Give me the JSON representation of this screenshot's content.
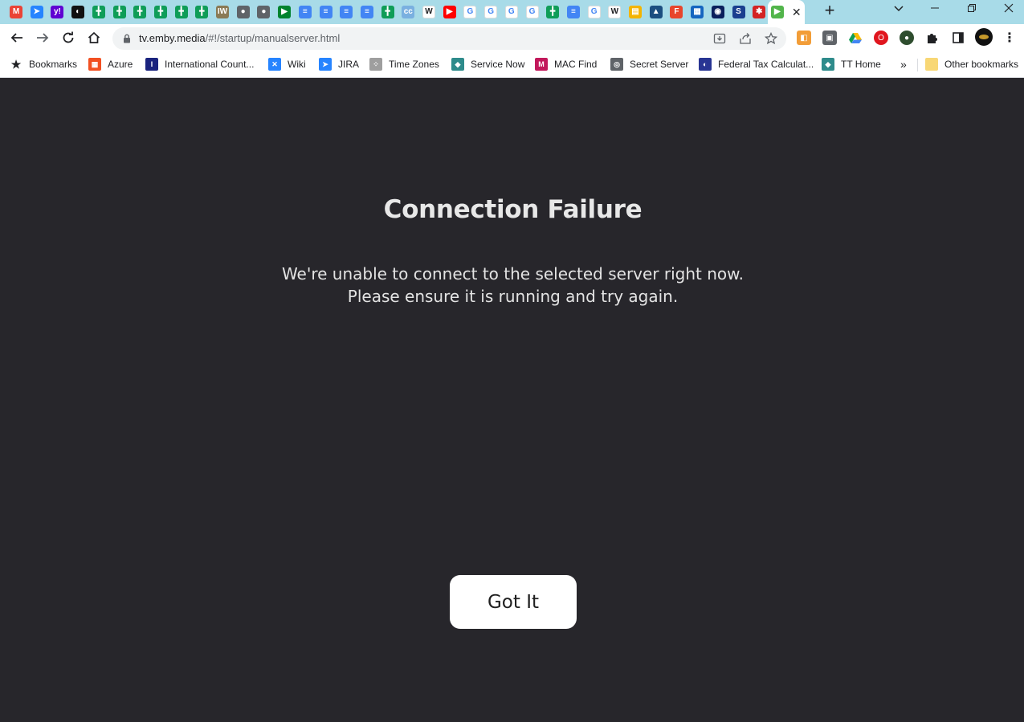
{
  "browser": {
    "tabs": [
      {
        "icon": "gmail-icon",
        "color": "#ea4335",
        "glyph": "M"
      },
      {
        "icon": "jira-icon",
        "color": "#2684ff",
        "glyph": "➤"
      },
      {
        "icon": "yahoo-icon",
        "color": "#6001d2",
        "glyph": "y!"
      },
      {
        "icon": "compass-icon",
        "color": "#111111",
        "glyph": "◐"
      },
      {
        "icon": "sheets-icon",
        "color": "#0f9d58",
        "glyph": "╋"
      },
      {
        "icon": "sheets-icon",
        "color": "#0f9d58",
        "glyph": "╋"
      },
      {
        "icon": "sheets-icon",
        "color": "#0f9d58",
        "glyph": "╋"
      },
      {
        "icon": "sheets-icon",
        "color": "#0f9d58",
        "glyph": "╋"
      },
      {
        "icon": "sheets-icon",
        "color": "#0f9d58",
        "glyph": "╋"
      },
      {
        "icon": "sheets-icon",
        "color": "#0f9d58",
        "glyph": "╋"
      },
      {
        "icon": "iw-icon",
        "color": "#8a7a55",
        "glyph": "IW"
      },
      {
        "icon": "globe-icon",
        "color": "#5f6368",
        "glyph": "●"
      },
      {
        "icon": "globe-icon",
        "color": "#5f6368",
        "glyph": "●"
      },
      {
        "icon": "meet-icon",
        "color": "#00832d",
        "glyph": "▶"
      },
      {
        "icon": "docs-icon",
        "color": "#4285f4",
        "glyph": "≡"
      },
      {
        "icon": "docs-icon",
        "color": "#4285f4",
        "glyph": "≡"
      },
      {
        "icon": "docs-icon",
        "color": "#4285f4",
        "glyph": "≡"
      },
      {
        "icon": "docs-icon",
        "color": "#4285f4",
        "glyph": "≡"
      },
      {
        "icon": "sheets-icon",
        "color": "#0f9d58",
        "glyph": "╋"
      },
      {
        "icon": "cc-icon",
        "color": "#7ab0e0",
        "glyph": "cc"
      },
      {
        "icon": "wikipedia-icon",
        "color": "#ffffff",
        "glyph": "W"
      },
      {
        "icon": "youtube-icon",
        "color": "#ff0000",
        "glyph": "▶"
      },
      {
        "icon": "google-icon",
        "color": "#ffffff",
        "glyph": "G"
      },
      {
        "icon": "google-icon",
        "color": "#ffffff",
        "glyph": "G"
      },
      {
        "icon": "google-icon",
        "color": "#ffffff",
        "glyph": "G"
      },
      {
        "icon": "google-icon",
        "color": "#ffffff",
        "glyph": "G"
      },
      {
        "icon": "sheets-icon",
        "color": "#0f9d58",
        "glyph": "╋"
      },
      {
        "icon": "docs-icon",
        "color": "#4285f4",
        "glyph": "≡"
      },
      {
        "icon": "google-icon",
        "color": "#ffffff",
        "glyph": "G"
      },
      {
        "icon": "wikipedia-icon",
        "color": "#ffffff",
        "glyph": "W"
      },
      {
        "icon": "keep-icon",
        "color": "#f4b400",
        "glyph": "▤"
      },
      {
        "icon": "stocks-icon",
        "color": "#1c4e80",
        "glyph": "▲"
      },
      {
        "icon": "f-icon",
        "color": "#e8452c",
        "glyph": "F"
      },
      {
        "icon": "photo-icon",
        "color": "#1565c0",
        "glyph": "▦"
      },
      {
        "icon": "planet-icon",
        "color": "#0b1f5c",
        "glyph": "◉"
      },
      {
        "icon": "s-icon",
        "color": "#1a3f8f",
        "glyph": "S"
      },
      {
        "icon": "yelp-icon",
        "color": "#d32323",
        "glyph": "✱"
      },
      {
        "icon": "emby-icon",
        "color": "#52b54b",
        "glyph": "▶",
        "active": true
      }
    ],
    "new_tab_label": "+",
    "tab_close_label": "✕",
    "url": {
      "host": "tv.emby.media",
      "path": "/#!/startup/manualserver.html"
    },
    "bookmarks": [
      {
        "label": "Bookmarks",
        "icon": "star-icon",
        "color": "#202124",
        "glyph": "★"
      },
      {
        "label": "Azure",
        "icon": "windows-icon",
        "color": "#f25022",
        "glyph": "▦"
      },
      {
        "label": "International Count...",
        "icon": "globe-map-icon",
        "color": "#1a237e",
        "glyph": "I"
      },
      {
        "label": "Wiki",
        "icon": "confluence-icon",
        "color": "#2684ff",
        "glyph": "✕"
      },
      {
        "label": "JIRA",
        "icon": "jira-icon",
        "color": "#2684ff",
        "glyph": "➤"
      },
      {
        "label": "Time Zones",
        "icon": "timezones-icon",
        "color": "#9e9e9e",
        "glyph": "⁘"
      },
      {
        "label": "Service Now",
        "icon": "servicenow-icon",
        "color": "#2e8b8b",
        "glyph": "◆"
      },
      {
        "label": "MAC Find",
        "icon": "macfind-icon",
        "color": "#c2185b",
        "glyph": "M"
      },
      {
        "label": "Secret Server",
        "icon": "lock-circle-icon",
        "color": "#5f6368",
        "glyph": "◎"
      },
      {
        "label": "Federal Tax Calculat...",
        "icon": "tax-icon",
        "color": "#283593",
        "glyph": "◐"
      },
      {
        "label": "TT Home",
        "icon": "tt-icon",
        "color": "#2e8b8b",
        "glyph": "◆"
      }
    ],
    "more_bookmarks_label": "»",
    "other_bookmarks_label": "Other bookmarks"
  },
  "page": {
    "title": "Connection Failure",
    "message_line1": "We're unable to connect to the selected server right now.",
    "message_line2": "Please ensure it is running and try again.",
    "button_label": "Got It"
  }
}
